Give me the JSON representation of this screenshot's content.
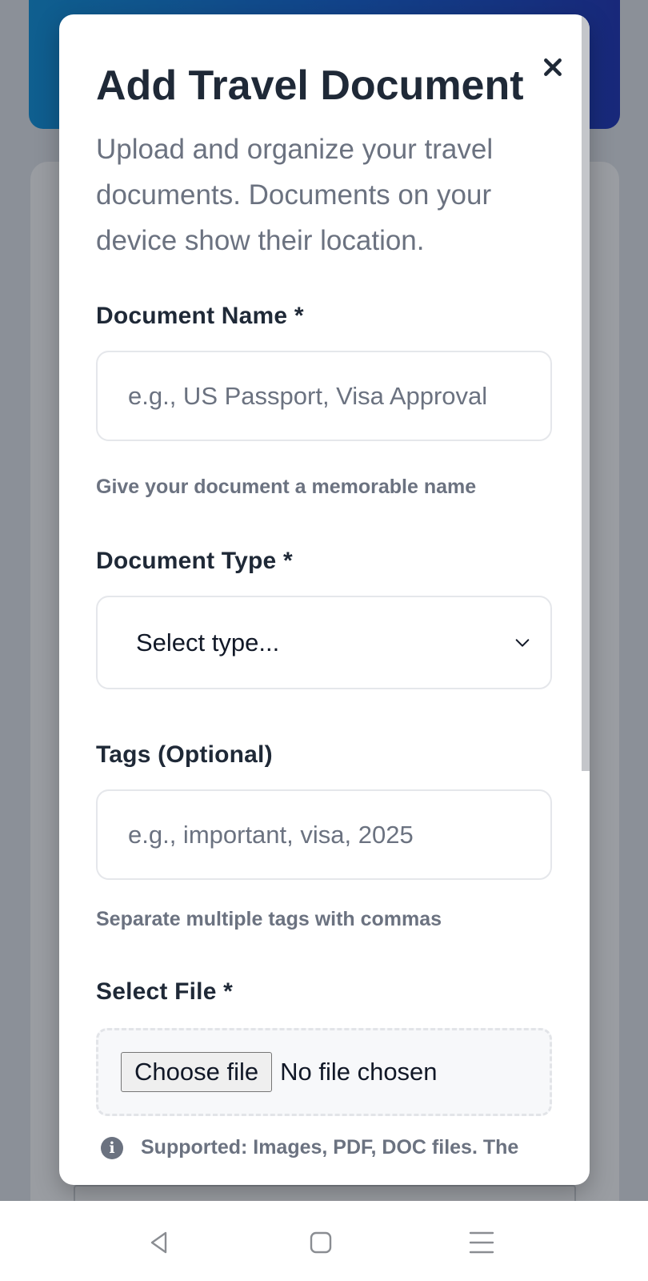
{
  "modal": {
    "title": "Add Travel Document",
    "subtitle": "Upload and organize your travel documents. Documents on your device show their location.",
    "close_icon": "close-icon"
  },
  "fields": {
    "document_name": {
      "label": "Document Name *",
      "placeholder": "e.g., US Passport, Visa Approval",
      "value": "",
      "help": "Give your document a memorable name"
    },
    "document_type": {
      "label": "Document Type *",
      "selected": "Select type..."
    },
    "tags": {
      "label": "Tags (Optional)",
      "placeholder": "e.g., important, visa, 2025",
      "value": "",
      "help": "Separate multiple tags with commas"
    },
    "file": {
      "label": "Select File *",
      "button_label": "Choose file",
      "status": "No file chosen",
      "support_text": "Supported: Images, PDF, DOC files. The"
    }
  },
  "nav_bar": {
    "back_icon": "back-triangle-icon",
    "home_icon": "home-square-icon",
    "menu_icon": "menu-lines-icon"
  },
  "colors": {
    "header_gradient_start": "#0f5f8f",
    "header_gradient_end": "#18287a",
    "title_text": "#1f2937",
    "muted_text": "#6b7280"
  }
}
